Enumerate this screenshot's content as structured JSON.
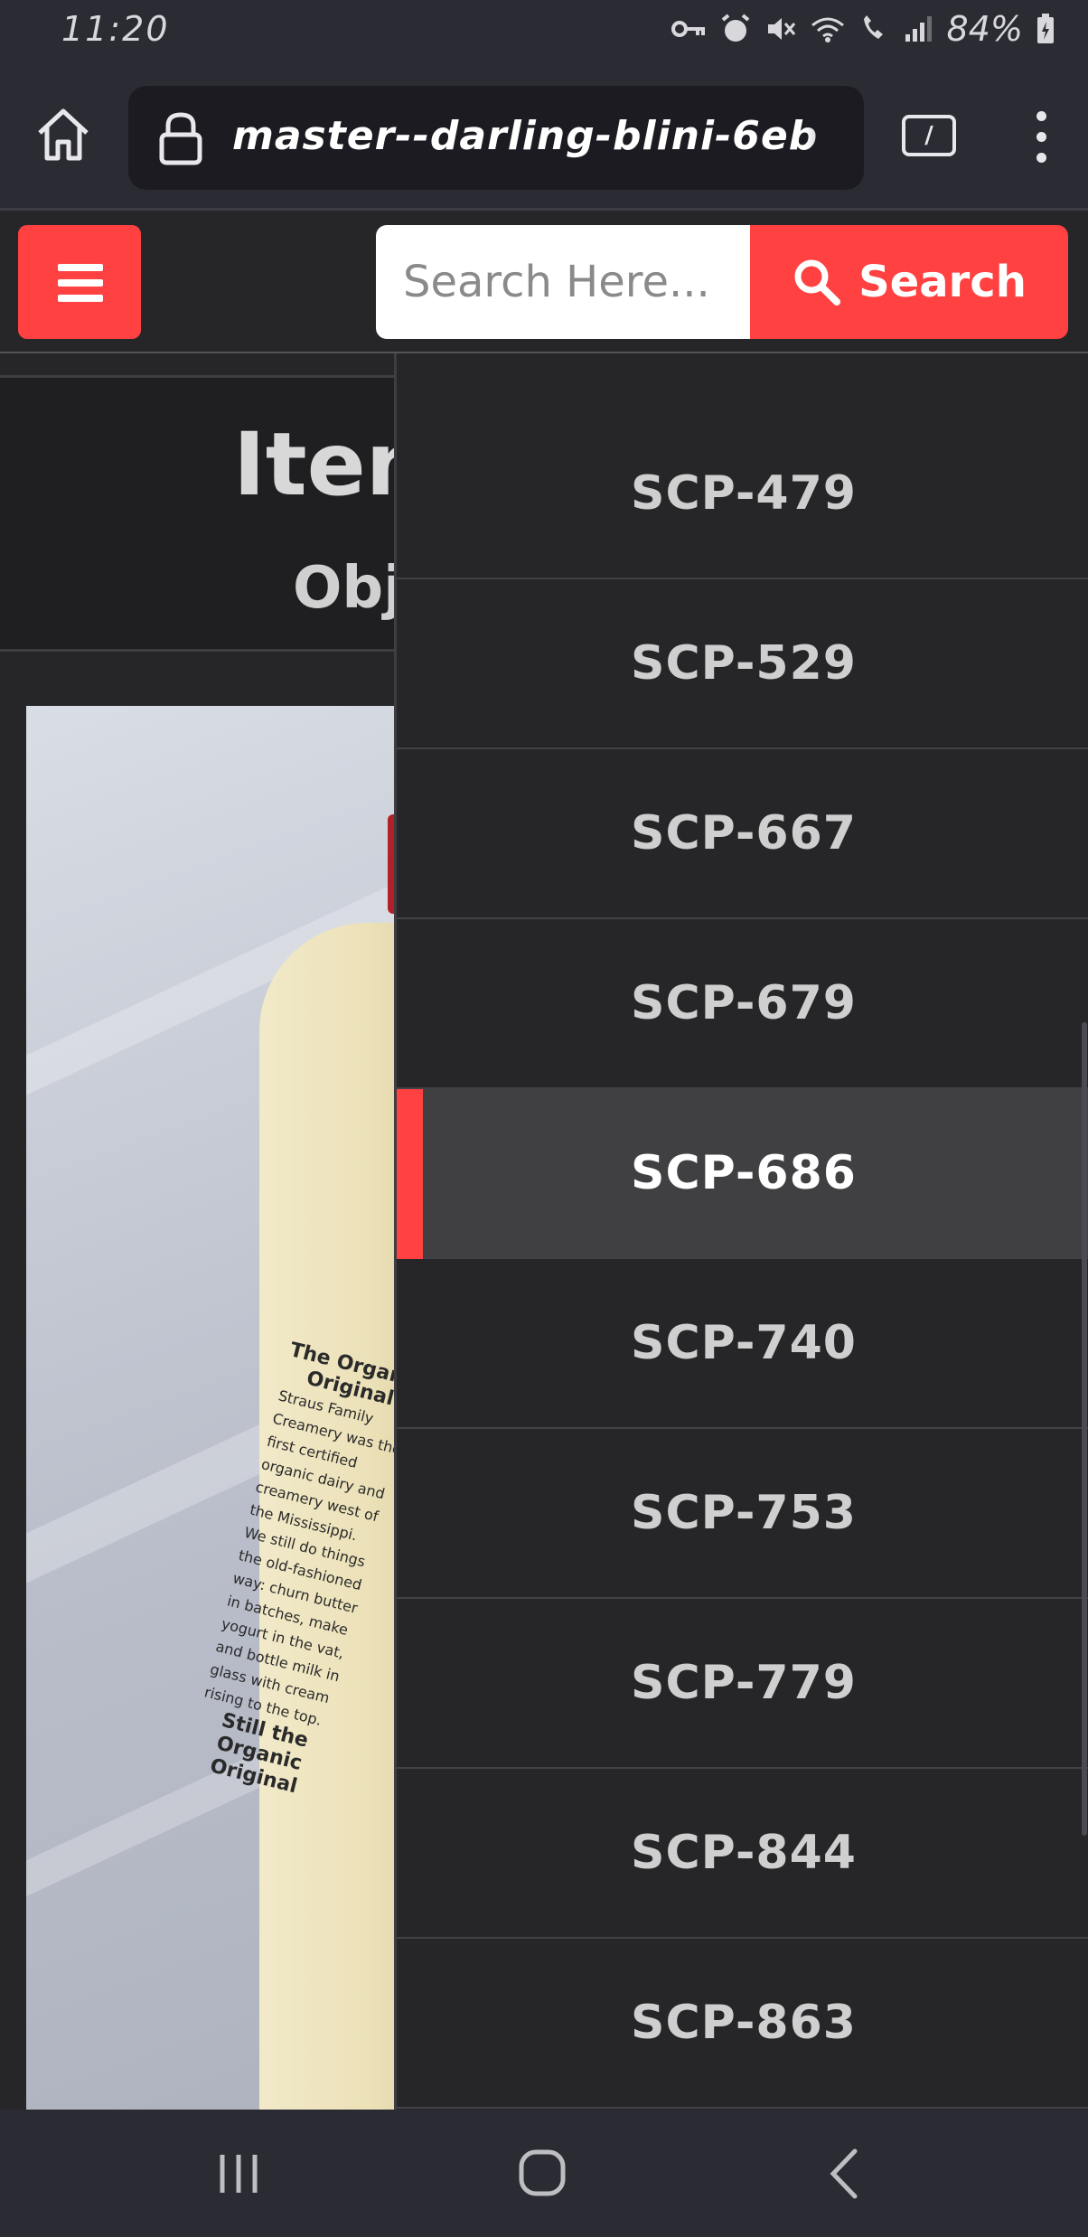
{
  "status_bar": {
    "time": "11:20",
    "battery": "84%"
  },
  "browser": {
    "url": "master--darling-blini-6eb"
  },
  "site_header": {
    "search_placeholder": "Search Here...",
    "search_button_label": "Search"
  },
  "content": {
    "title_fragment": "Item",
    "subtitle_fragment": "Obj"
  },
  "bottle_label": {
    "heading": "The Organic Original",
    "body": "Straus Family Creamery was the first certified organic dairy and creamery west of the Mississippi. We still do things the old-fashioned way: churn butter in batches, make yogurt in the vat, and bottle milk in glass with cream rising to the top.",
    "footer": "Still the Organic Original"
  },
  "dropdown": {
    "items": [
      "SCP-479",
      "SCP-529",
      "SCP-667",
      "SCP-679",
      "SCP-686",
      "SCP-740",
      "SCP-753",
      "SCP-779",
      "SCP-844",
      "SCP-863"
    ],
    "active_index": 4
  },
  "colors": {
    "accent": "#ff4141",
    "background": "#262629",
    "bar": "#2b2b33"
  }
}
